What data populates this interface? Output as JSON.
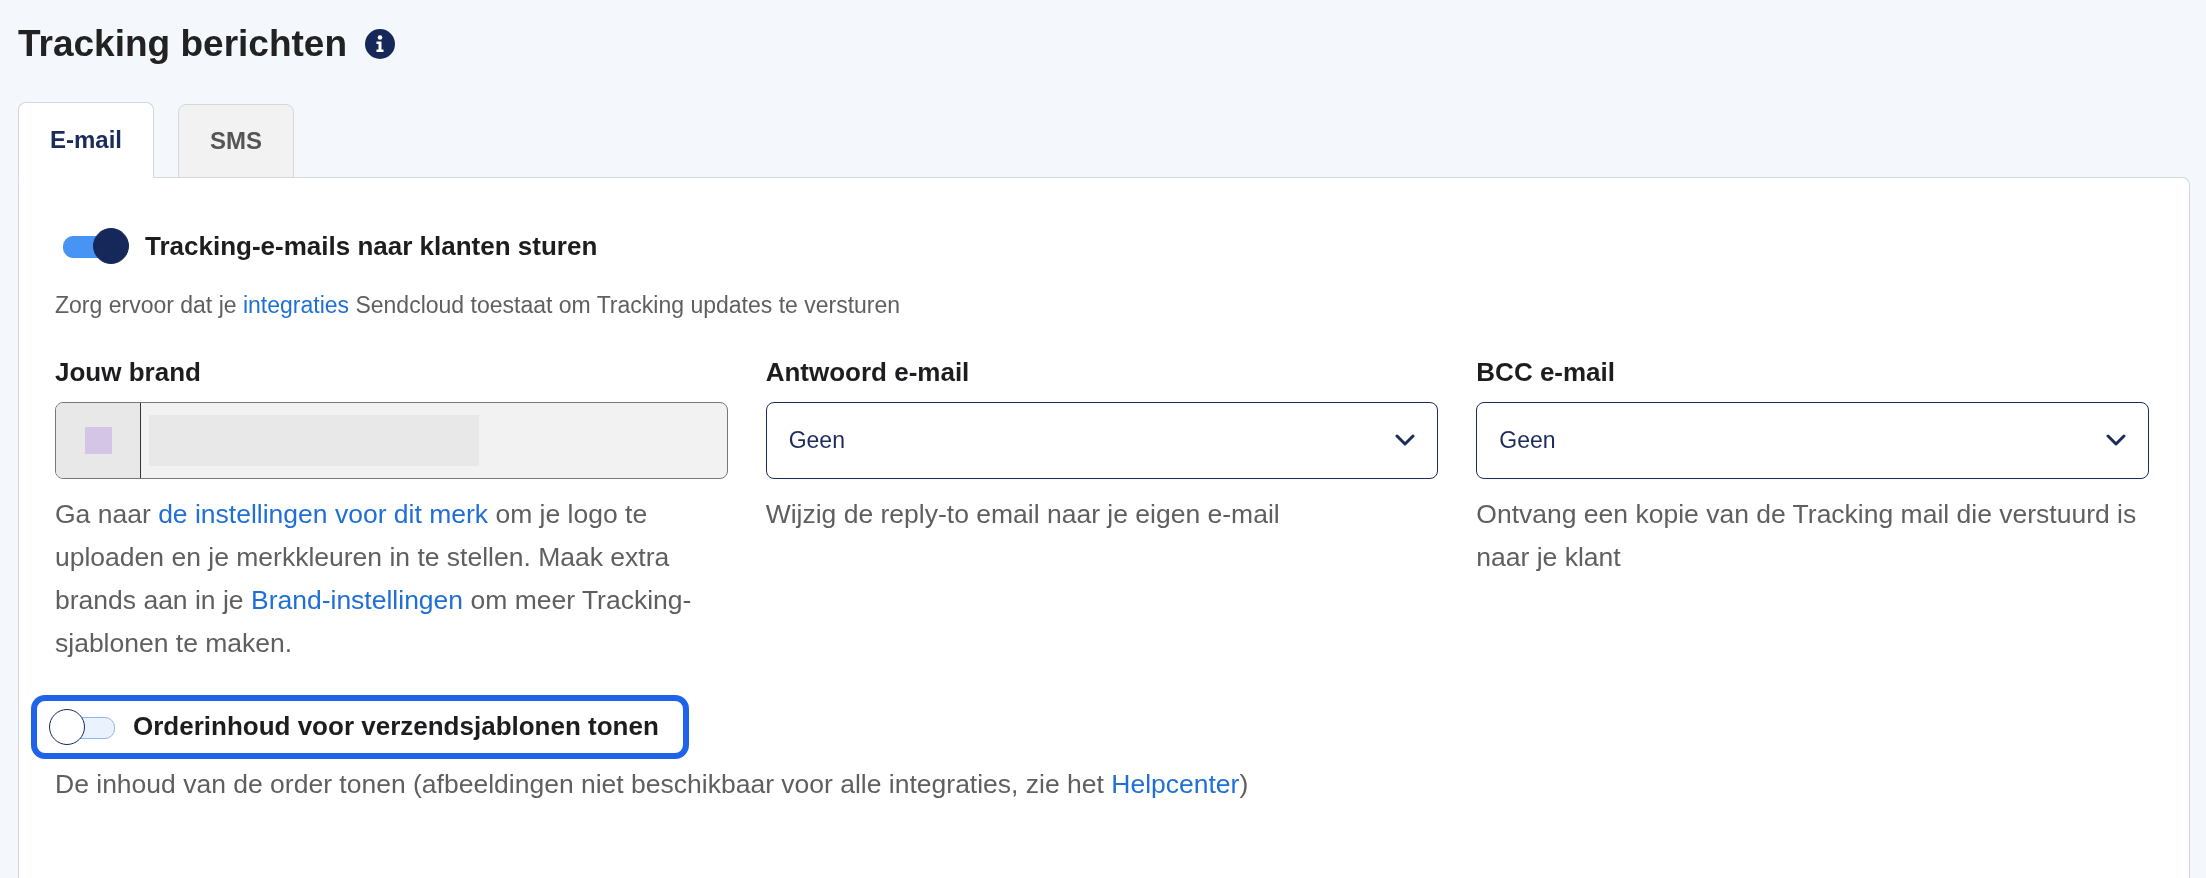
{
  "page": {
    "title": "Tracking berichten"
  },
  "tabs": [
    {
      "label": "E-mail",
      "selected": true
    },
    {
      "label": "SMS",
      "selected": false
    }
  ],
  "email_toggle": {
    "label": "Tracking-e-mails naar klanten sturen",
    "on": true,
    "highlighted": false,
    "description": [
      {
        "kind": "text",
        "text": "Zorg ervoor dat je "
      },
      {
        "kind": "link",
        "text": "integraties"
      },
      {
        "kind": "text",
        "text": " Sendcloud toestaat om Tracking updates te versturen"
      }
    ]
  },
  "fields": [
    {
      "kind": "brand",
      "label": "Jouw brand",
      "disabled": true,
      "help": [
        {
          "kind": "text",
          "text": "Ga naar "
        },
        {
          "kind": "link",
          "text": "de instellingen voor dit merk"
        },
        {
          "kind": "text",
          "text": " om je logo te uploaden en je merkkleuren in te stellen. Maak extra brands aan in je "
        },
        {
          "kind": "link",
          "text": "Brand-instellingen"
        },
        {
          "kind": "text",
          "text": " om meer Tracking-sjablonen te maken."
        }
      ]
    },
    {
      "kind": "select",
      "label": "Antwoord e-mail",
      "value": "Geen",
      "help": [
        {
          "kind": "text",
          "text": "Wijzig de reply-to email naar je eigen e-mail"
        }
      ]
    },
    {
      "kind": "select",
      "label": "BCC e-mail",
      "value": "Geen",
      "help": [
        {
          "kind": "text",
          "text": "Ontvang een kopie van de Tracking mail die verstuurd is naar je klant"
        }
      ]
    }
  ],
  "order_toggle": {
    "label": "Orderinhoud voor verzendsjablonen tonen",
    "on": false,
    "highlighted": true,
    "description": [
      {
        "kind": "text",
        "text": "De inhoud van de order tonen (afbeeldingen niet beschikbaar voor alle integraties, zie het "
      },
      {
        "kind": "link",
        "text": "Helpcenter"
      },
      {
        "kind": "text",
        "text": ")"
      }
    ]
  }
}
